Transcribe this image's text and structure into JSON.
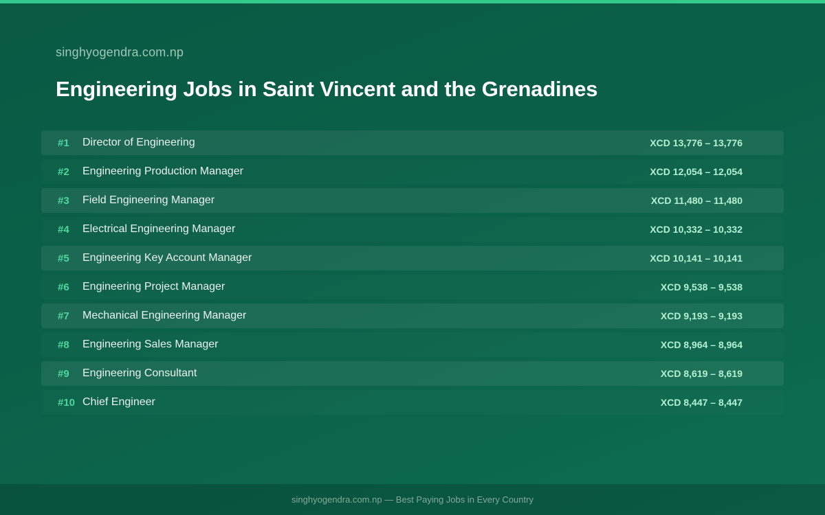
{
  "site": "singhyogendra.com.np",
  "title": "Engineering Jobs in Saint Vincent and the Grenadines",
  "jobs": [
    {
      "rank": "#1",
      "title": "Director of Engineering",
      "salary": "XCD 13,776 – 13,776"
    },
    {
      "rank": "#2",
      "title": "Engineering Production Manager",
      "salary": "XCD 12,054 – 12,054"
    },
    {
      "rank": "#3",
      "title": "Field Engineering Manager",
      "salary": "XCD 11,480 – 11,480"
    },
    {
      "rank": "#4",
      "title": "Electrical Engineering Manager",
      "salary": "XCD 10,332 – 10,332"
    },
    {
      "rank": "#5",
      "title": "Engineering Key Account Manager",
      "salary": "XCD 10,141 – 10,141"
    },
    {
      "rank": "#6",
      "title": "Engineering Project Manager",
      "salary": "XCD 9,538 – 9,538"
    },
    {
      "rank": "#7",
      "title": "Mechanical Engineering Manager",
      "salary": "XCD 9,193 – 9,193"
    },
    {
      "rank": "#8",
      "title": "Engineering Sales Manager",
      "salary": "XCD 8,964 – 8,964"
    },
    {
      "rank": "#9",
      "title": "Engineering Consultant",
      "salary": "XCD 8,619 – 8,619"
    },
    {
      "rank": "#10",
      "title": "Chief Engineer",
      "salary": "XCD 8,447 – 8,447"
    }
  ],
  "footer": "singhyogendra.com.np — Best Paying Jobs in Every Country",
  "colors": {
    "accent": "#34c98c",
    "rank": "#4fd69c",
    "salary": "#b4f0d2",
    "background": "#0b5f48"
  }
}
